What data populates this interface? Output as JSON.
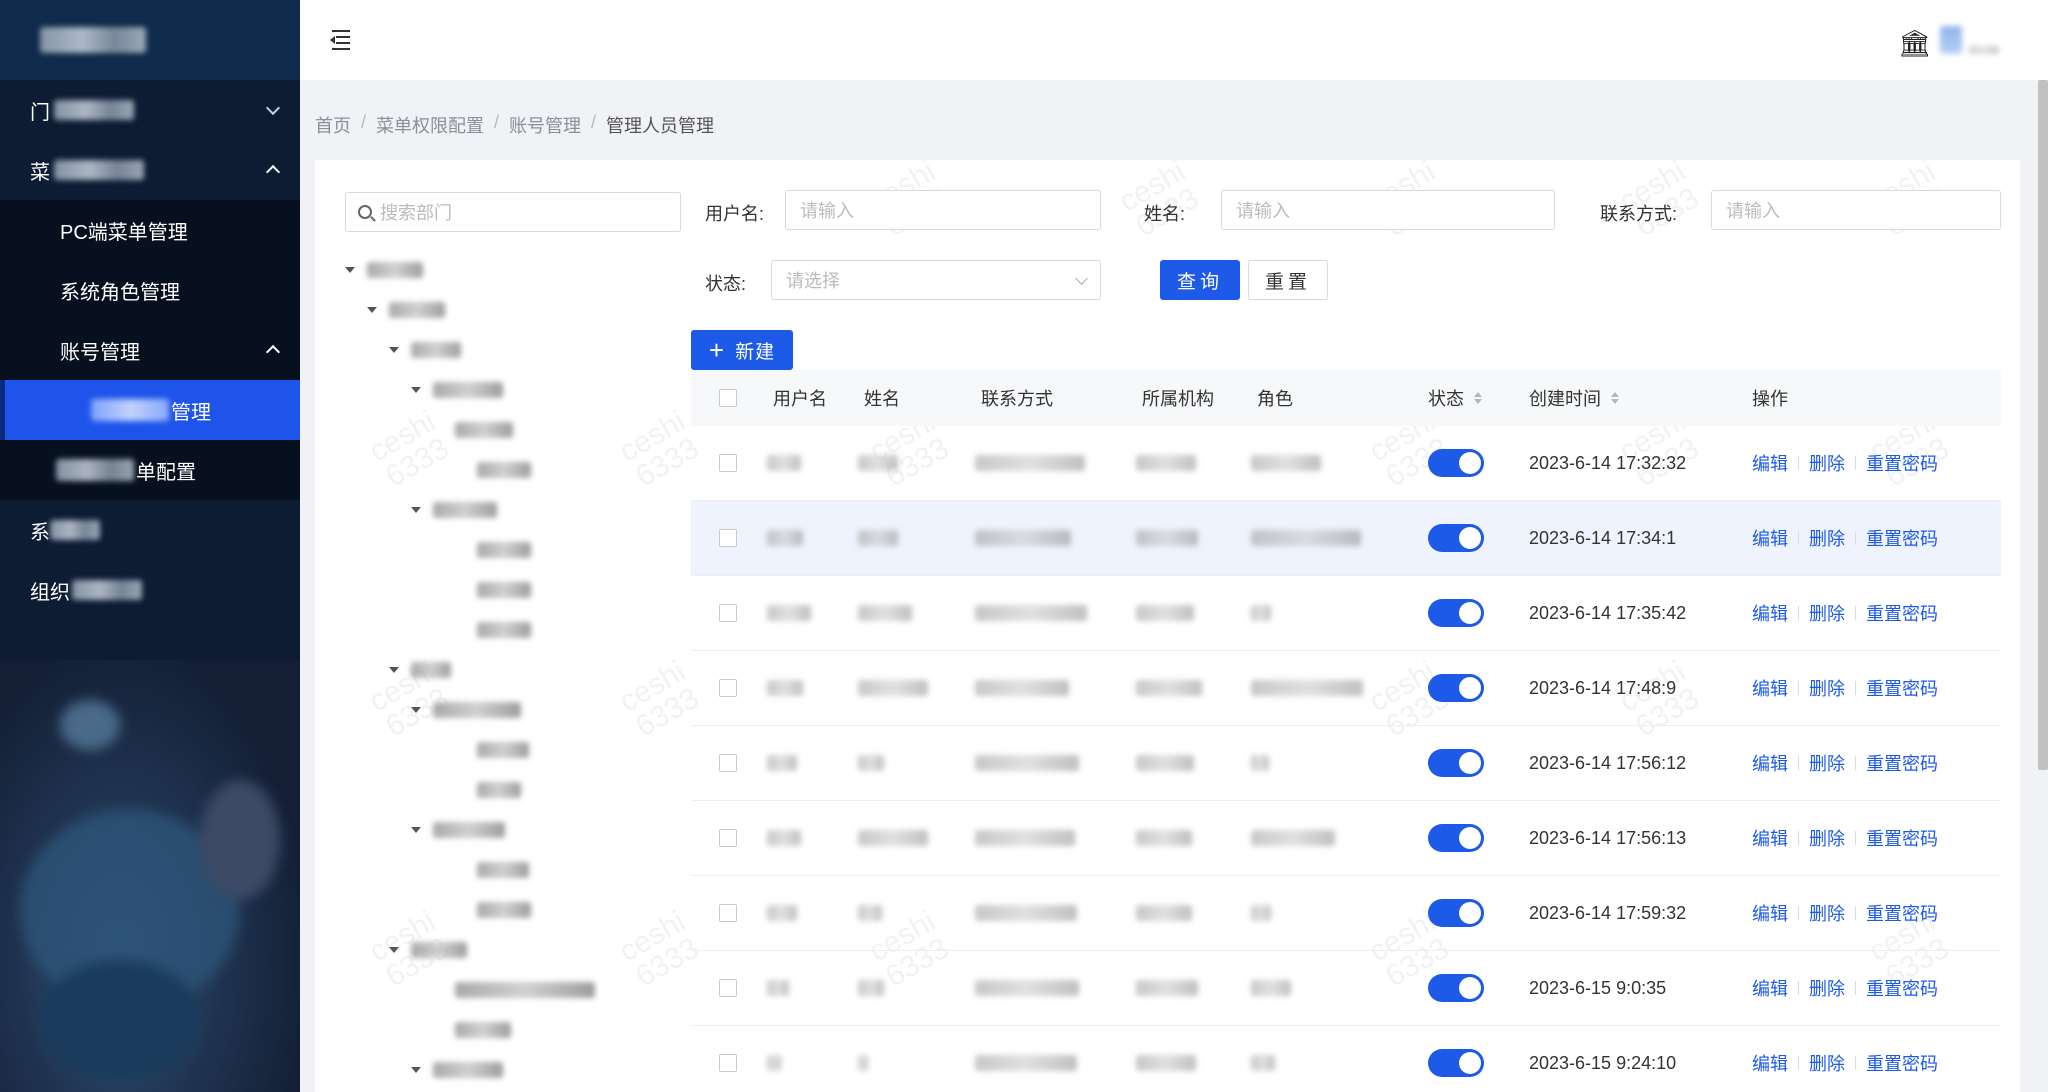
{
  "sidebar": {
    "menu": [
      {
        "label": "门户",
        "expanded": false
      },
      {
        "label": "菜单权限配置",
        "expanded": true
      },
      {
        "label": "PC端菜单管理"
      },
      {
        "label": "系统角色管理"
      },
      {
        "label": "账号管理",
        "expanded": true
      },
      {
        "label": "管理",
        "active": true
      },
      {
        "label": "单配置"
      },
      {
        "label": "系"
      },
      {
        "label": "组织"
      }
    ]
  },
  "header": {
    "bank_icon": "bank-icon",
    "fold_icon": "menu-fold-icon"
  },
  "breadcrumb": [
    "首页",
    "菜单权限配置",
    "账号管理",
    "管理人员管理"
  ],
  "breadcrumb_sep": "/",
  "tree": {
    "search_placeholder": "搜索部门"
  },
  "filters": {
    "username_label": "用户名:",
    "username_placeholder": "请输入",
    "name_label": "姓名:",
    "name_placeholder": "请输入",
    "contact_label": "联系方式:",
    "contact_placeholder": "请输入",
    "status_label": "状态:",
    "status_placeholder": "请选择",
    "query_button": "查询",
    "reset_button": "重置",
    "new_button": "新建"
  },
  "table": {
    "columns": [
      "用户名",
      "姓名",
      "联系方式",
      "所属机构",
      "角色",
      "状态",
      "创建时间",
      "操作"
    ],
    "rows": [
      {
        "created": "2023-6-14 17:32:32"
      },
      {
        "created": "2023-6-14 17:34:1"
      },
      {
        "created": "2023-6-14 17:35:42"
      },
      {
        "created": "2023-6-14 17:48:9"
      },
      {
        "created": "2023-6-14 17:56:12"
      },
      {
        "created": "2023-6-14 17:56:13"
      },
      {
        "created": "2023-6-14 17:59:32"
      },
      {
        "created": "2023-6-15 9:0:35"
      },
      {
        "created": "2023-6-15 9:24:10"
      }
    ],
    "actions": {
      "edit": "编辑",
      "delete": "删除",
      "reset_password": "重置密码"
    }
  },
  "watermark": {
    "line1": "ceshi",
    "line2": "6333"
  },
  "colors": {
    "primary": "#1d5ae8",
    "sidebar_bg": "#0d1b33",
    "active": "#1e54ea"
  }
}
